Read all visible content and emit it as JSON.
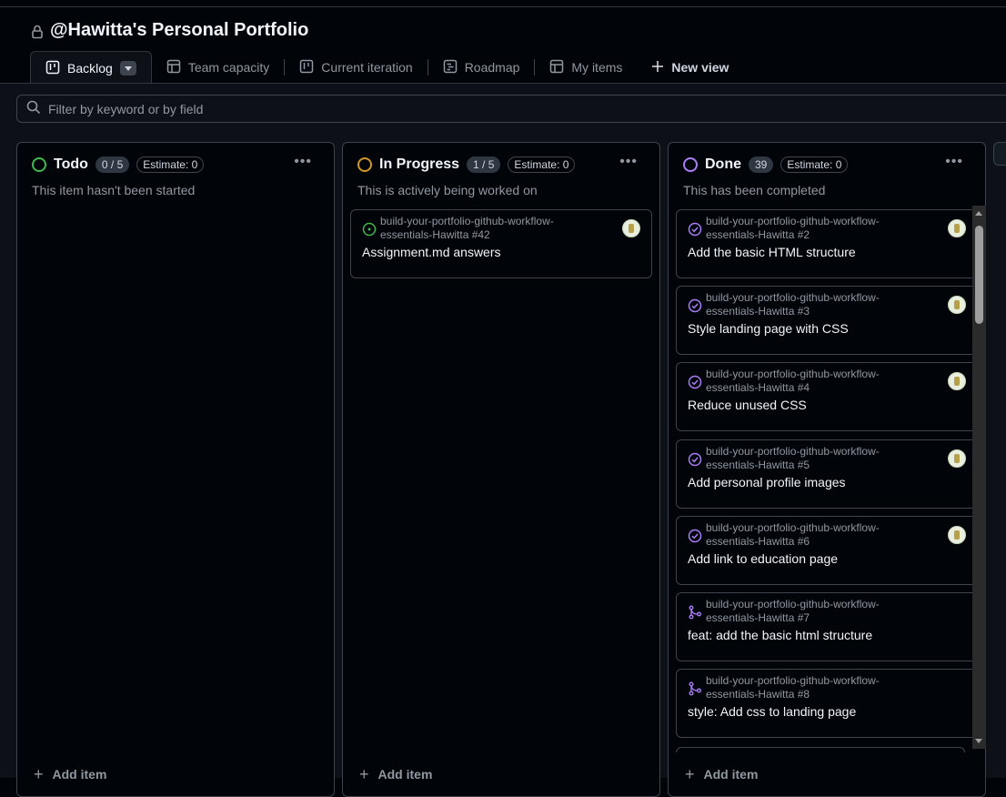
{
  "project": {
    "title": "@Hawitta's Personal Portfolio"
  },
  "tabs": [
    {
      "label": "Backlog",
      "active": true,
      "icon": "board-icon"
    },
    {
      "label": "Team capacity",
      "icon": "table-icon"
    },
    {
      "label": "Current iteration",
      "icon": "board-icon"
    },
    {
      "label": "Roadmap",
      "icon": "roadmap-icon"
    },
    {
      "label": "My items",
      "icon": "table-icon"
    }
  ],
  "new_view": {
    "label": "New view"
  },
  "filter": {
    "placeholder": "Filter by keyword or by field"
  },
  "colors": {
    "todo": "#3fb950",
    "in_progress": "#d29922",
    "done": "#ab7df8",
    "open_issue": "#3fb950"
  },
  "columns": [
    {
      "name": "Todo",
      "count": "0 / 5",
      "estimate": "Estimate: 0",
      "description": "This item hasn't been started",
      "add_item": "Add item",
      "cards": []
    },
    {
      "name": "In Progress",
      "count": "1 / 5",
      "estimate": "Estimate: 0",
      "description": "This is actively being worked on",
      "add_item": "Add item",
      "cards": [
        {
          "repo": "build-your-portfolio-github-workflow-essentials-Hawitta #42",
          "title": "Assignment.md answers",
          "type": "open-issue"
        }
      ]
    },
    {
      "name": "Done",
      "count": "39",
      "estimate": "Estimate: 0",
      "description": "This has been completed",
      "add_item": "Add item",
      "cards": [
        {
          "repo": "build-your-portfolio-github-workflow-essentials-Hawitta #2",
          "title": "Add the basic HTML structure",
          "type": "closed-issue"
        },
        {
          "repo": "build-your-portfolio-github-workflow-essentials-Hawitta #3",
          "title": "Style landing page with CSS",
          "type": "closed-issue"
        },
        {
          "repo": "build-your-portfolio-github-workflow-essentials-Hawitta #4",
          "title": "Reduce unused CSS",
          "type": "closed-issue"
        },
        {
          "repo": "build-your-portfolio-github-workflow-essentials-Hawitta #5",
          "title": "Add personal profile images",
          "type": "closed-issue"
        },
        {
          "repo": "build-your-portfolio-github-workflow-essentials-Hawitta #6",
          "title": "Add link to education page",
          "type": "closed-issue"
        },
        {
          "repo": "build-your-portfolio-github-workflow-essentials-Hawitta #7",
          "title": "feat: add the basic html structure",
          "type": "merged-pr"
        },
        {
          "repo": "build-your-portfolio-github-workflow-essentials-Hawitta #8",
          "title": "style: Add css to landing page",
          "type": "merged-pr"
        }
      ]
    }
  ]
}
